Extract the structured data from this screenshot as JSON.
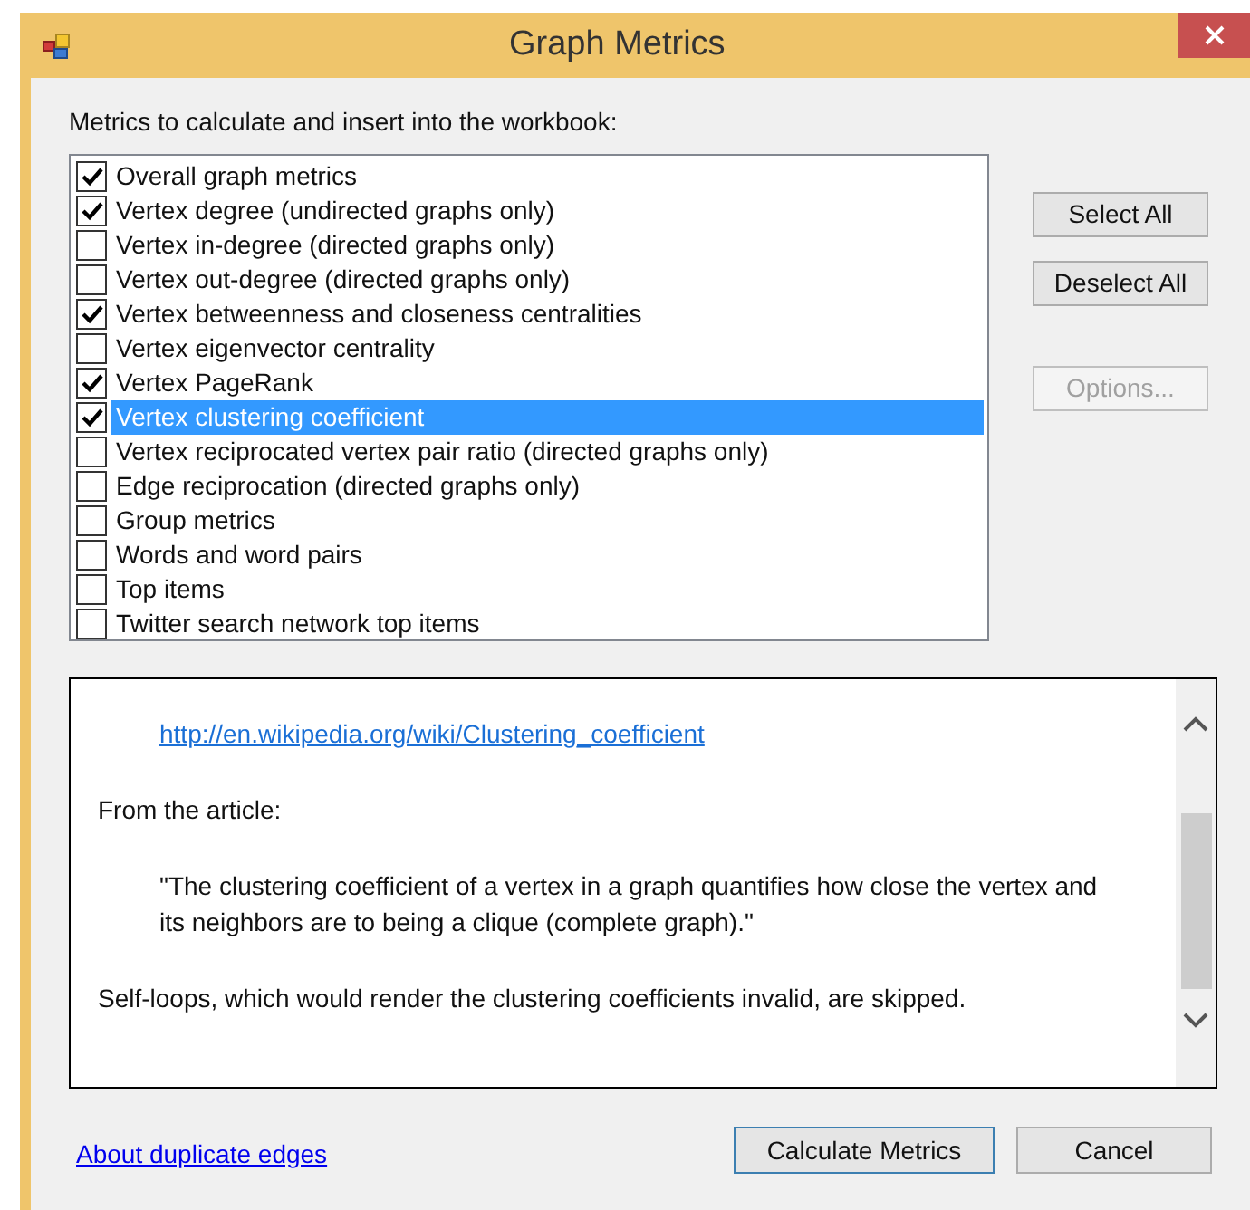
{
  "window": {
    "title": "Graph Metrics"
  },
  "metrics_label": "Metrics to calculate and insert into the workbook:",
  "metrics": [
    {
      "label": "Overall graph metrics",
      "checked": true,
      "selected": false
    },
    {
      "label": "Vertex degree (undirected graphs only)",
      "checked": true,
      "selected": false
    },
    {
      "label": "Vertex in-degree (directed graphs only)",
      "checked": false,
      "selected": false
    },
    {
      "label": "Vertex out-degree (directed graphs only)",
      "checked": false,
      "selected": false
    },
    {
      "label": "Vertex betweenness and closeness centralities",
      "checked": true,
      "selected": false
    },
    {
      "label": "Vertex eigenvector centrality",
      "checked": false,
      "selected": false
    },
    {
      "label": "Vertex PageRank",
      "checked": true,
      "selected": false
    },
    {
      "label": "Vertex clustering coefficient",
      "checked": true,
      "selected": true
    },
    {
      "label": "Vertex reciprocated vertex pair ratio (directed graphs only)",
      "checked": false,
      "selected": false
    },
    {
      "label": "Edge reciprocation (directed graphs only)",
      "checked": false,
      "selected": false
    },
    {
      "label": "Group metrics",
      "checked": false,
      "selected": false
    },
    {
      "label": "Words and word pairs",
      "checked": false,
      "selected": false
    },
    {
      "label": "Top items",
      "checked": false,
      "selected": false
    },
    {
      "label": "Twitter search network top items",
      "checked": false,
      "selected": false
    }
  ],
  "side_buttons": [
    {
      "label": "Select All",
      "disabled": false
    },
    {
      "label": "Deselect All",
      "disabled": false
    },
    {
      "label": "Options...",
      "disabled": true
    }
  ],
  "description": [
    {
      "kind": "link",
      "text": "http://en.wikipedia.org/wiki/Clustering_coefficient"
    },
    {
      "kind": "text",
      "text": "From the article:"
    },
    {
      "kind": "quote",
      "text": "\"The clustering coefficient of a vertex in a graph quantifies how close the vertex and its neighbors are to being a clique (complete graph).\""
    },
    {
      "kind": "text",
      "text": "Self-loops, which would render the clustering coefficients invalid, are skipped."
    }
  ],
  "footer": {
    "link": "About duplicate edges",
    "buttons": [
      {
        "label": "Calculate Metrics",
        "default": true
      },
      {
        "label": "Cancel",
        "default": false
      }
    ]
  }
}
